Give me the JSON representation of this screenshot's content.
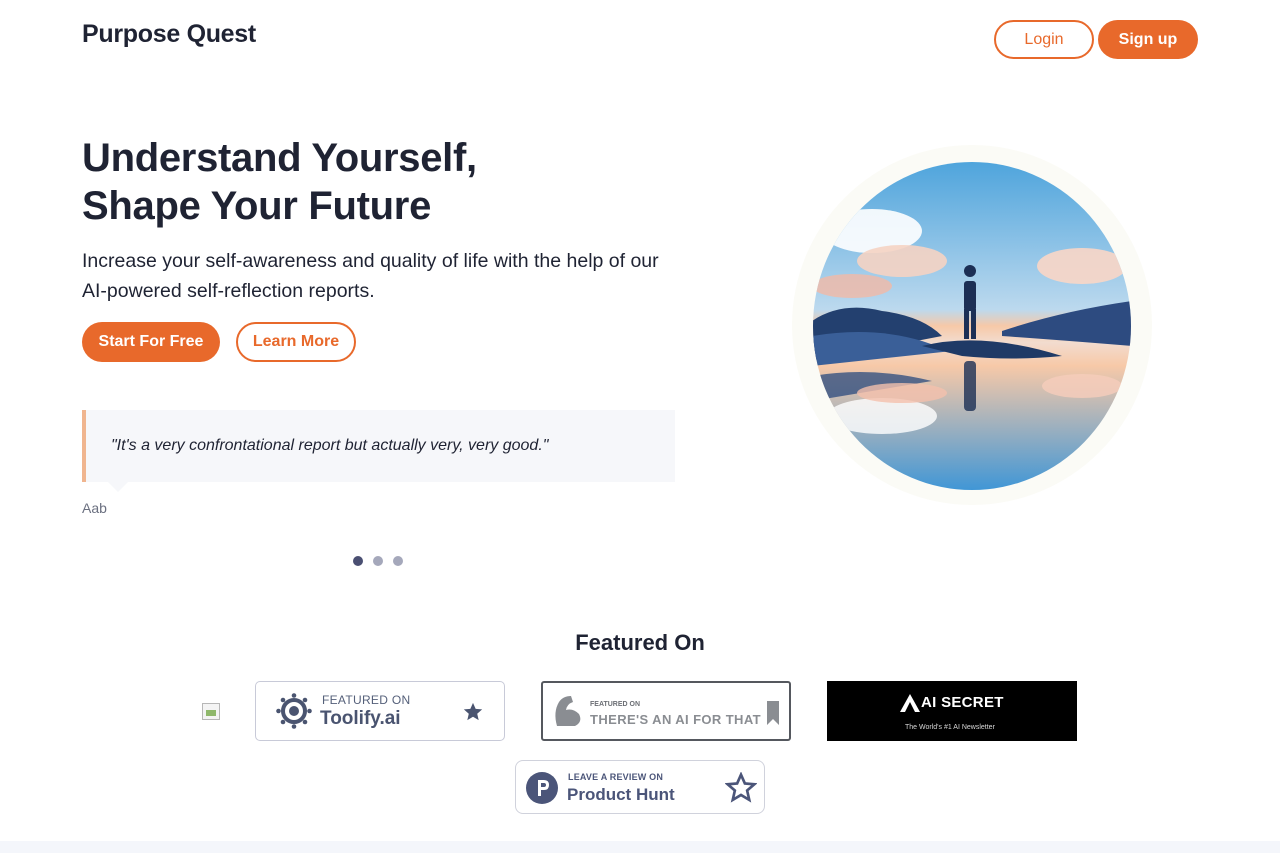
{
  "header": {
    "brand": "Purpose Quest",
    "login_label": "Login",
    "signup_label": "Sign up"
  },
  "hero": {
    "title_line1": "Understand Yourself,",
    "title_line2": "Shape Your Future",
    "subtitle": "Increase your self-awareness and quality of life with the help of our AI-powered self-reflection reports.",
    "start_label": "Start For Free",
    "learn_label": "Learn More"
  },
  "testimonial": {
    "quote": "\"It's a very confrontational report but actually very, very good.\"",
    "author": "Aab",
    "slides_total": 3,
    "active_slide": 1
  },
  "featured": {
    "title": "Featured On",
    "toolify": {
      "small": "FEATURED ON",
      "big": "Toolify.ai"
    },
    "aift": {
      "small": "FEATURED ON",
      "big": "THERE'S AN AI FOR THAT"
    },
    "aisecret": {
      "big": "AI SECRET",
      "small": "The World's #1 AI Newsletter"
    },
    "producthunt": {
      "small": "LEAVE A REVIEW ON",
      "big": "Product Hunt"
    }
  },
  "colors": {
    "accent": "#e8692b",
    "text": "#1f2333",
    "quote_bg": "#f6f7fa",
    "quote_border": "#f0b58f"
  }
}
